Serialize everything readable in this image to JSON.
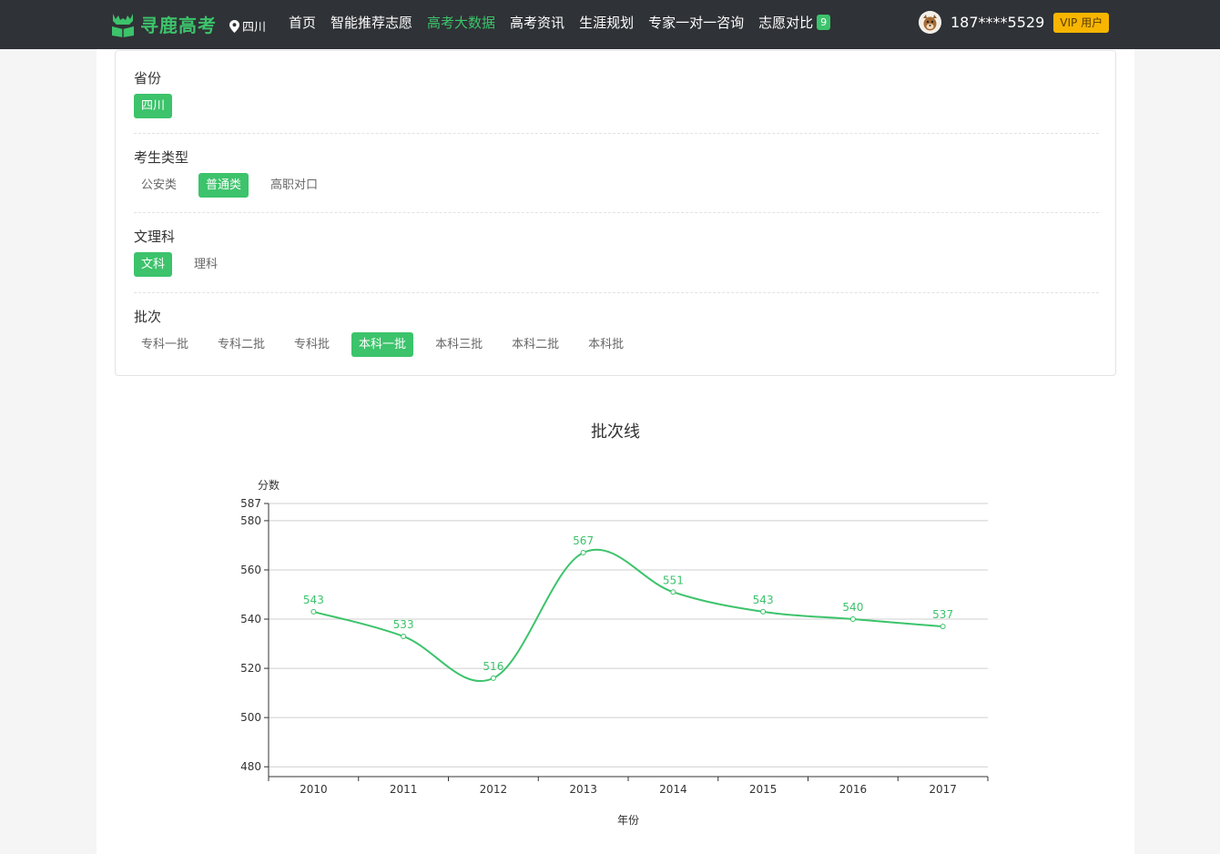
{
  "header": {
    "brand": "寻鹿高考",
    "location": "四川",
    "nav": [
      {
        "label": "首页",
        "active": false
      },
      {
        "label": "智能推荐志愿",
        "active": false
      },
      {
        "label": "高考大数据",
        "active": true
      },
      {
        "label": "高考资讯",
        "active": false
      },
      {
        "label": "生涯规划",
        "active": false
      },
      {
        "label": "专家一对一咨询",
        "active": false
      },
      {
        "label": "志愿对比",
        "active": false
      }
    ],
    "compare_count": "9",
    "user_phone": "187****5529",
    "vip_label": "VIP 用户"
  },
  "filters": {
    "province": {
      "title": "省份",
      "options": [
        "四川"
      ],
      "selected": "四川"
    },
    "student_type": {
      "title": "考生类型",
      "options": [
        "公安类",
        "普通类",
        "高职对口"
      ],
      "selected": "普通类"
    },
    "subject": {
      "title": "文理科",
      "options": [
        "文科",
        "理科"
      ],
      "selected": "文科"
    },
    "batch": {
      "title": "批次",
      "options": [
        "专科一批",
        "专科二批",
        "专科批",
        "本科一批",
        "本科三批",
        "本科二批",
        "本科批"
      ],
      "selected": "本科一批"
    }
  },
  "colors": {
    "accent": "#3cc36b",
    "nav_bg": "#2f3236",
    "vip": "#f7b500"
  },
  "chart_data": {
    "type": "line",
    "title": "批次线",
    "xlabel": "年份",
    "ylabel": "分数",
    "categories": [
      "2010",
      "2011",
      "2012",
      "2013",
      "2014",
      "2015",
      "2016",
      "2017"
    ],
    "values": [
      543,
      533,
      516,
      567,
      551,
      543,
      540,
      537
    ],
    "ylim": [
      476,
      587
    ],
    "yticks": [
      480,
      500,
      520,
      540,
      560,
      580,
      587
    ],
    "grid": true,
    "smooth": true,
    "color": "#3cc36b"
  }
}
